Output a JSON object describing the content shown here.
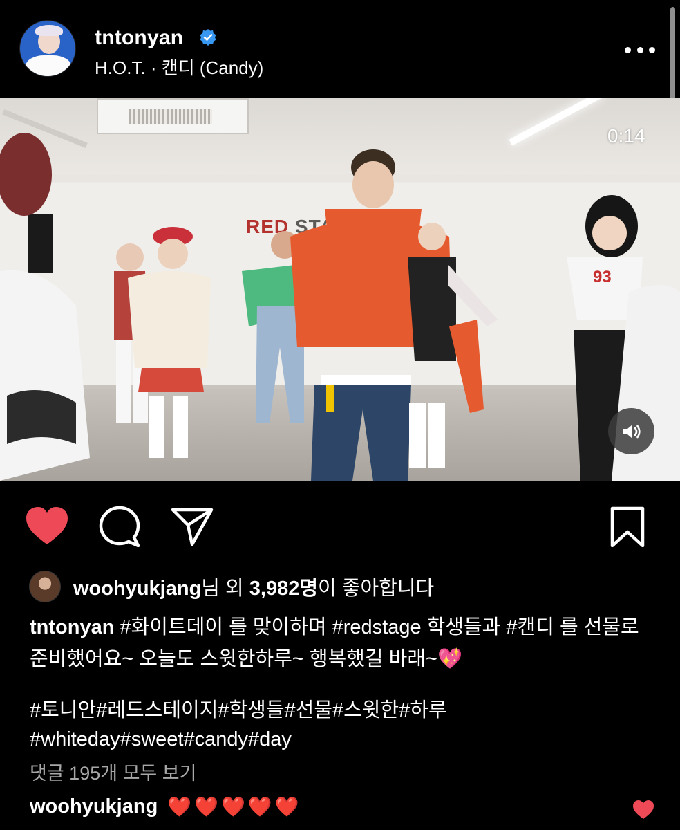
{
  "post": {
    "username": "tntonyan",
    "verified": true,
    "audio": "H.O.T. · 캔디 (Candy)",
    "more_icon": "more-horizontal-icon"
  },
  "video": {
    "timestamp": "0:14",
    "wall_sign": "RED STA",
    "wall_sign_accent": "RED",
    "wall_sign_rest": " STA",
    "sound_icon": "speaker-icon"
  },
  "actions": {
    "like_icon": "heart-filled-icon",
    "comment_icon": "comment-icon",
    "share_icon": "send-icon",
    "save_icon": "bookmark-icon",
    "liked": true
  },
  "likes": {
    "user": "woohyukjang",
    "text_mid": "님 외 ",
    "count": "3,982명",
    "text_end": "이 좋아합니다"
  },
  "caption": {
    "user": "tntonyan",
    "text": " #화이트데이 를 맞이하며 #redstage 학생들과 #캔디 를 선물로 준비했어요~ 오늘도 스윗한하루~ 행복했길 바래~💖",
    "tags_line1": "#토니안#레드스테이지#학생들#선물#스윗한#하루",
    "tags_line2": "#whiteday#sweet#candy#day"
  },
  "comments": {
    "view_all": "댓글 195개 모두 보기",
    "top_comment_user": "woohyukjang",
    "top_comment_text": "❤️❤️❤️❤️❤️"
  },
  "colors": {
    "background": "#000000",
    "like_red": "#ed4956",
    "verified_blue": "#3897f0",
    "muted_text": "#a8a8a8"
  }
}
